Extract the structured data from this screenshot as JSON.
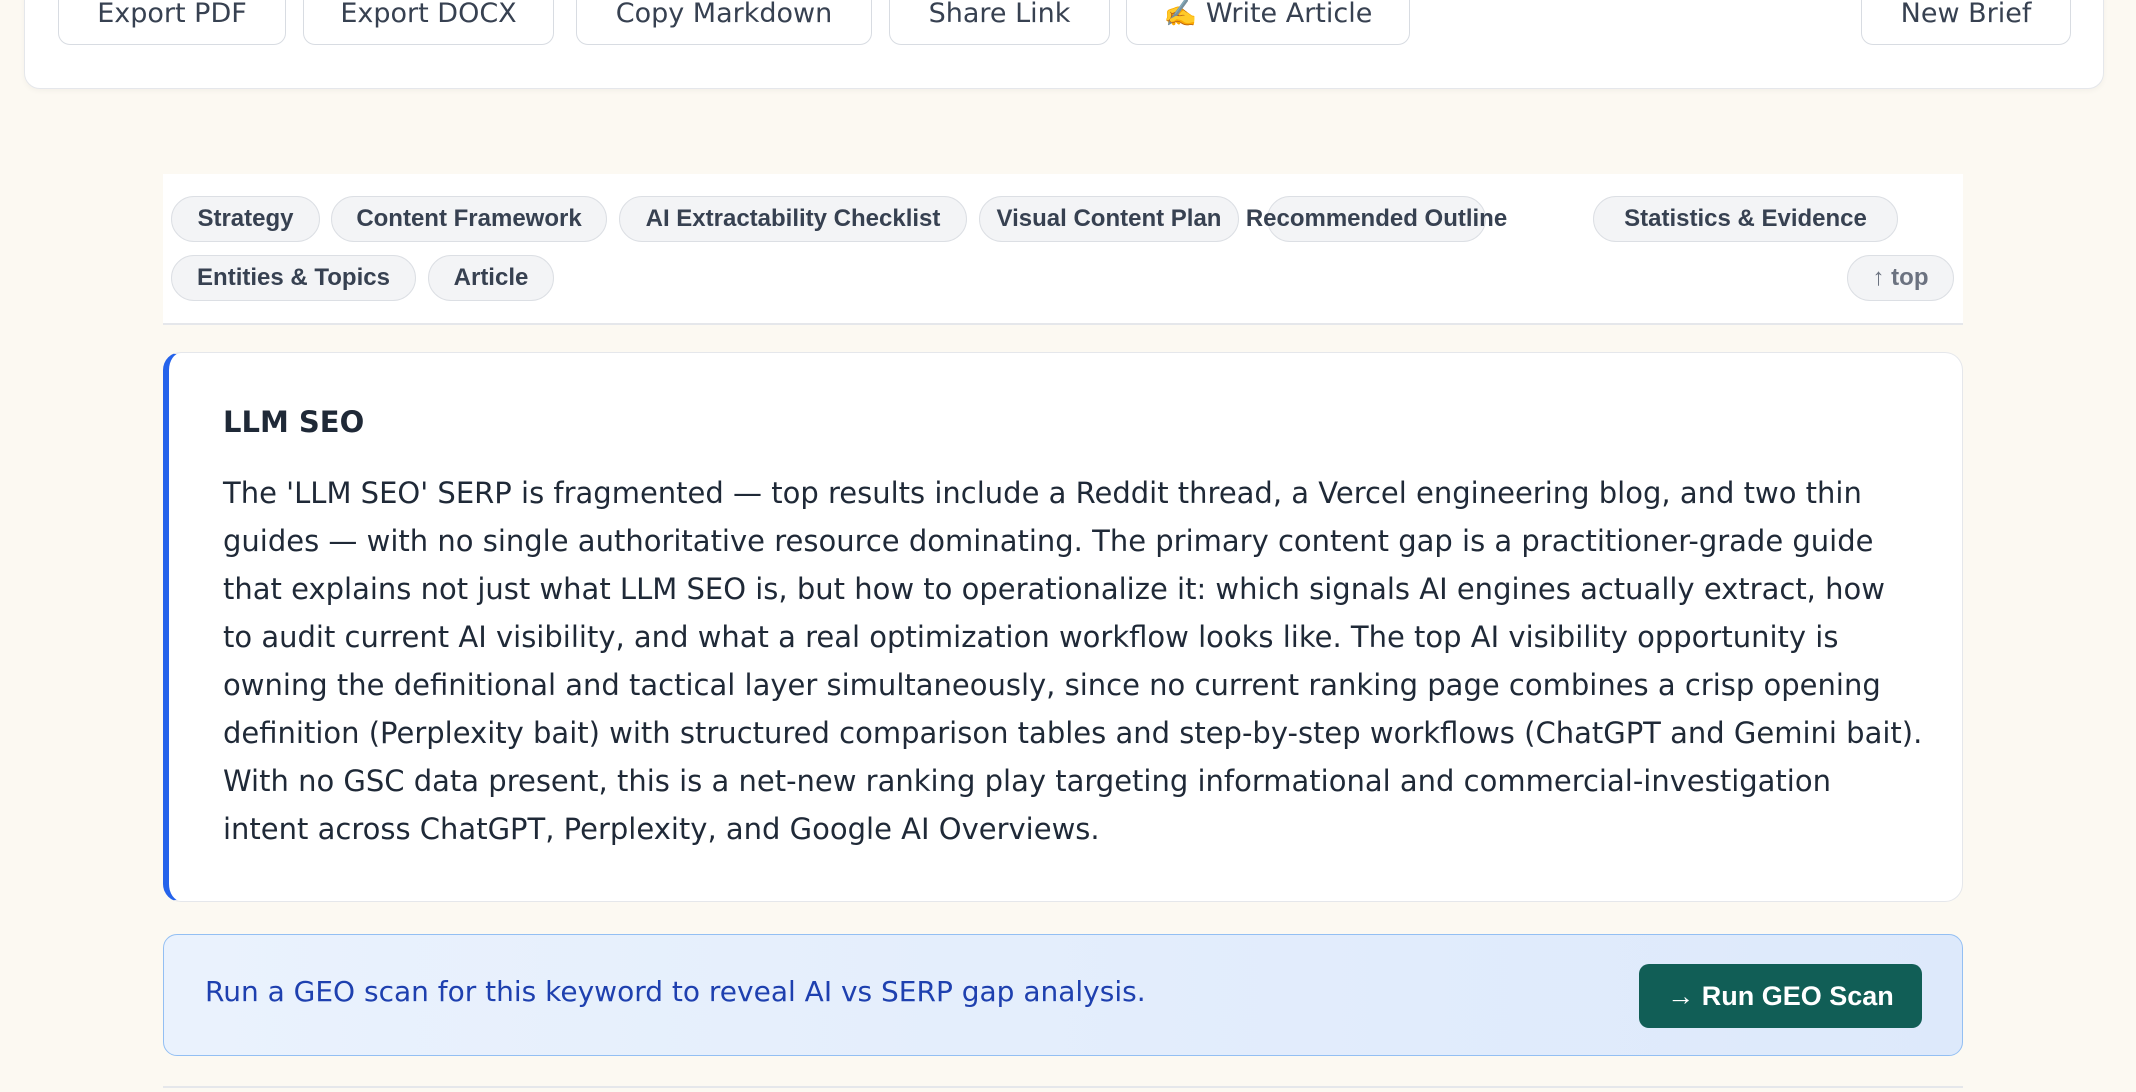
{
  "toolbar": {
    "export_pdf": "Export PDF",
    "export_docx": "Export DOCX",
    "copy_markdown": "Copy Markdown",
    "share_link": "Share Link",
    "write_article": "✍️ Write Article",
    "new_brief": "New Brief"
  },
  "section_nav": {
    "items": [
      "Strategy",
      "Content Framework",
      "AI Extractability Checklist",
      "Visual Content Plan",
      "Recommended Outline",
      "Statistics & Evidence",
      "Entities & Topics",
      "Article"
    ],
    "top_label": "↑ top"
  },
  "summary": {
    "title": "LLM SEO",
    "text": "The 'LLM SEO' SERP is fragmented — top results include a Reddit thread, a Vercel engineering blog, and two thin guides — with no single authoritative resource dominating. The primary content gap is a practitioner-grade guide that explains not just what LLM SEO is, but how to operationalize it: which signals AI engines actually extract, how to audit current AI visibility, and what a real optimization workflow looks like. The top AI visibility opportunity is owning the definitional and tactical layer simultaneously, since no current ranking page combines a crisp opening definition (Perplexity bait) with structured comparison tables and step-by-step workflows (ChatGPT and Gemini bait). With no GSC data present, this is a net-new ranking play targeting informational and commercial-investigation intent across ChatGPT, Perplexity, and Google AI Overviews."
  },
  "geo_banner": {
    "text": "Run a GEO scan for this keyword to reveal AI vs SERP gap analysis.",
    "button": "→ Run GEO Scan"
  },
  "colors": {
    "accent_blue": "#2563eb",
    "geo_button": "#115e56",
    "page_background": "#fcf9f2"
  }
}
